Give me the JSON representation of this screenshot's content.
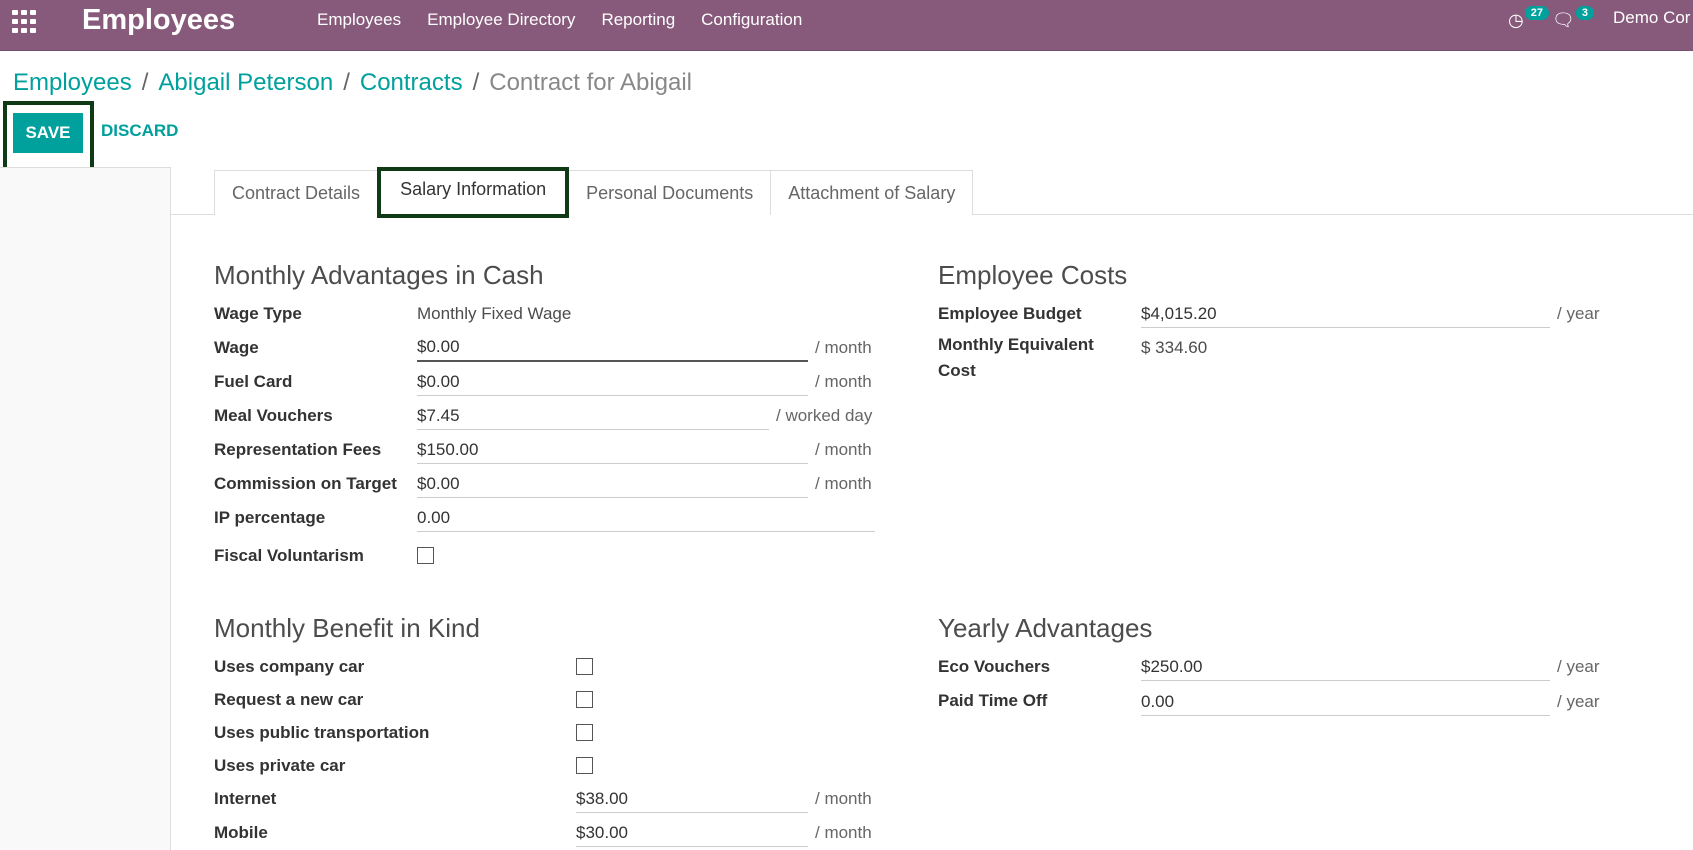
{
  "navbar": {
    "app_title": "Employees",
    "menu": [
      "Employees",
      "Employee Directory",
      "Reporting",
      "Configuration"
    ],
    "activity_count": "27",
    "message_count": "3",
    "company": "Demo Cor",
    "color": "#875a7b"
  },
  "breadcrumb": {
    "items": [
      "Employees",
      "Abigail Peterson",
      "Contracts"
    ],
    "separator": "/",
    "current": "Contract for Abigail"
  },
  "buttons": {
    "save": "SAVE",
    "discard": "DISCARD"
  },
  "tabs": [
    "Contract Details",
    "Salary Information",
    "Personal Documents",
    "Attachment of Salary"
  ],
  "cash": {
    "title": "Monthly Advantages in Cash",
    "wage_type_label": "Wage Type",
    "wage_type_value": "Monthly Fixed Wage",
    "wage_label": "Wage",
    "wage_value": "$0.00",
    "wage_unit": "/ month",
    "fuel_label": "Fuel Card",
    "fuel_value": "$0.00",
    "fuel_unit": "/ month",
    "meal_label": "Meal Vouchers",
    "meal_value": "$7.45",
    "meal_unit": "/ worked day",
    "repr_label": "Representation Fees",
    "repr_value": "$150.00",
    "repr_unit": "/ month",
    "commission_label": "Commission on Target",
    "commission_value": "$0.00",
    "commission_unit": "/ month",
    "ip_label": "IP percentage",
    "ip_value": "0.00",
    "fiscal_label": "Fiscal Voluntarism"
  },
  "costs": {
    "title": "Employee Costs",
    "budget_label": "Employee Budget",
    "budget_value": "$4,015.20",
    "budget_unit": "/ year",
    "monthly_label": "Monthly Equivalent Cost",
    "monthly_value": "$ 334.60"
  },
  "kind": {
    "title": "Monthly Benefit in Kind",
    "company_car_label": "Uses company car",
    "new_car_label": "Request a new car",
    "public_transport_label": "Uses public transportation",
    "private_car_label": "Uses private car",
    "internet_label": "Internet",
    "internet_value": "$38.00",
    "internet_unit": "/ month",
    "mobile_label": "Mobile",
    "mobile_value": "$30.00",
    "mobile_unit": "/ month"
  },
  "yearly": {
    "title": "Yearly Advantages",
    "eco_label": "Eco Vouchers",
    "eco_value": "$250.00",
    "eco_unit": "/ year",
    "pto_label": "Paid Time Off",
    "pto_value": "0.00",
    "pto_unit": "/ year"
  },
  "accent_color": "#00a09d"
}
